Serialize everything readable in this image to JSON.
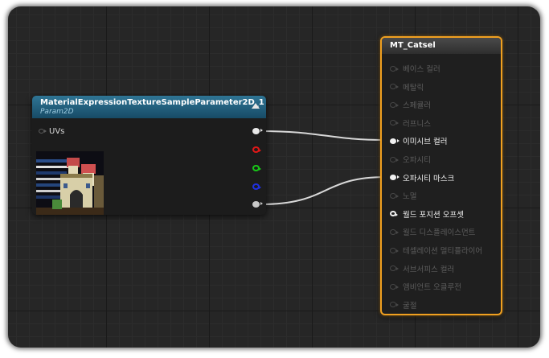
{
  "texture_node": {
    "title": "MaterialExpressionTextureSampleParameter2D_1",
    "subtitle": "Param2D",
    "input_pin": "UVs",
    "outputs": [
      {
        "name": "rgb",
        "color": "#e8e8e8"
      },
      {
        "name": "r",
        "color": "#e01818"
      },
      {
        "name": "g",
        "color": "#18c818"
      },
      {
        "name": "b",
        "color": "#2030e0"
      },
      {
        "name": "a",
        "color": "#c8c8c8"
      }
    ]
  },
  "material_node": {
    "title": "MT_Catsel",
    "inputs": [
      {
        "label": "베이스 컬러",
        "active": false
      },
      {
        "label": "메탈릭",
        "active": false
      },
      {
        "label": "스페큘러",
        "active": false
      },
      {
        "label": "러프니스",
        "active": false
      },
      {
        "label": "이미시브 컬러",
        "active": true
      },
      {
        "label": "오파시티",
        "active": false
      },
      {
        "label": "오파시티 마스크",
        "active": true
      },
      {
        "label": "노멀",
        "active": false
      },
      {
        "label": "월드 포지션 오프셋",
        "active": true
      },
      {
        "label": "월드 디스플레이스먼트",
        "active": false
      },
      {
        "label": "테셀레이션 멀티플라이어",
        "active": false
      },
      {
        "label": "서브서피스 컬러",
        "active": false
      },
      {
        "label": "앰비언트 오클루전",
        "active": false
      },
      {
        "label": "굴절",
        "active": false
      }
    ]
  },
  "colors": {
    "selection_outline": "#f0a020",
    "wire": "#d8d8d8"
  }
}
